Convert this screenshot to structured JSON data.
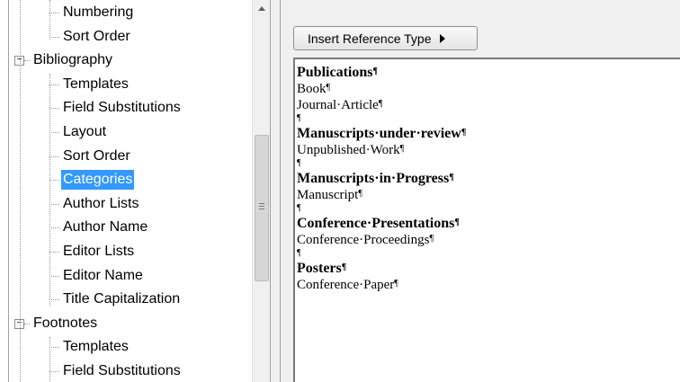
{
  "tree": {
    "nodes": [
      {
        "label": "Numbering",
        "level": 1
      },
      {
        "label": "Sort Order",
        "level": 1
      },
      {
        "label": "Bibliography",
        "level": 0,
        "expander": "−"
      },
      {
        "label": "Templates",
        "level": 1
      },
      {
        "label": "Field Substitutions",
        "level": 1
      },
      {
        "label": "Layout",
        "level": 1
      },
      {
        "label": "Sort Order",
        "level": 1
      },
      {
        "label": "Categories",
        "level": 1,
        "selected": true
      },
      {
        "label": "Author Lists",
        "level": 1
      },
      {
        "label": "Author Name",
        "level": 1
      },
      {
        "label": "Editor Lists",
        "level": 1
      },
      {
        "label": "Editor Name",
        "level": 1
      },
      {
        "label": "Title Capitalization",
        "level": 1
      },
      {
        "label": "Footnotes",
        "level": 0,
        "expander": "−"
      },
      {
        "label": "Templates",
        "level": 1
      },
      {
        "label": "Field Substitutions",
        "level": 1
      }
    ]
  },
  "toolbar": {
    "insert_reference_type_label": "Insert Reference Type"
  },
  "editor": {
    "pilcrow": "¶",
    "paragraphs": [
      {
        "text": "Publications",
        "style": "heading"
      },
      {
        "text": "Book",
        "style": "normal"
      },
      {
        "text": "Journal·Article",
        "style": "normal"
      },
      {
        "text": "",
        "style": "blank"
      },
      {
        "text": "Manuscripts·under·review",
        "style": "heading"
      },
      {
        "text": "Unpublished·Work",
        "style": "normal"
      },
      {
        "text": "",
        "style": "blank"
      },
      {
        "text": "Manuscripts·in·Progress",
        "style": "heading"
      },
      {
        "text": "Manuscript",
        "style": "normal"
      },
      {
        "text": "",
        "style": "blank"
      },
      {
        "text": "Conference·Presentations",
        "style": "heading"
      },
      {
        "text": "Conference·Proceedings",
        "style": "normal"
      },
      {
        "text": "",
        "style": "blank"
      },
      {
        "text": "Posters",
        "style": "heading"
      },
      {
        "text": "Conference·Paper",
        "style": "normal"
      }
    ]
  },
  "colors": {
    "selection": "#3399ff",
    "panel_background": "#f0f0f0"
  }
}
